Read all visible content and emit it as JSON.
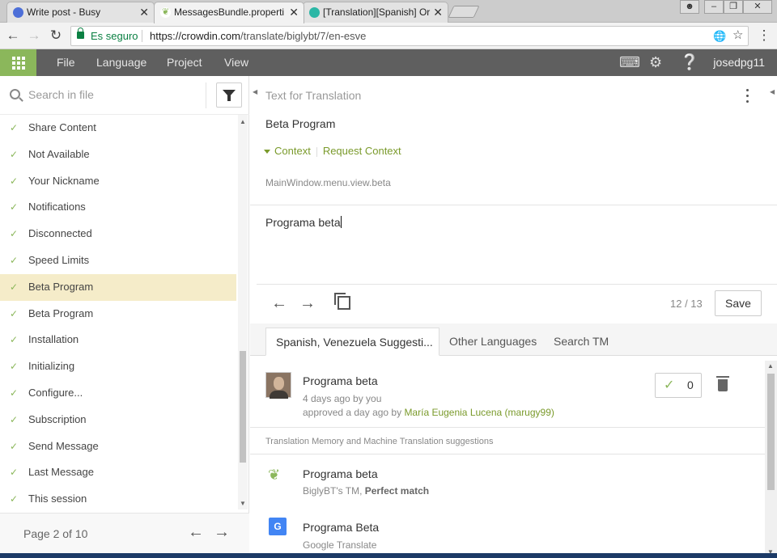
{
  "browser": {
    "tabs": [
      {
        "title": "Write post - Busy"
      },
      {
        "title": "MessagesBundle.properti"
      },
      {
        "title": "[Translation][Spanish] Or"
      }
    ],
    "security_label": "Es seguro",
    "url_host": "https://crowdin.com",
    "url_path": "/translate/biglybt/7/en-esve"
  },
  "appbar": {
    "menu": [
      "File",
      "Language",
      "Project",
      "View"
    ],
    "username": "josedpg11"
  },
  "sidebar": {
    "search_placeholder": "Search in file",
    "strings": [
      "Share Content",
      "Not Available",
      "Your Nickname",
      "Notifications",
      "Disconnected",
      "Speed Limits",
      "Beta Program",
      "Beta Program",
      "Installation",
      "Initializing",
      "Configure...",
      "Subscription",
      "Send Message",
      "Last Message",
      "This session"
    ],
    "selected_index": 6,
    "pager": "Page 2 of 10"
  },
  "editor": {
    "header": "Text for Translation",
    "source_text": "Beta Program",
    "context_label": "Context",
    "request_context_label": "Request Context",
    "context_key": "MainWindow.menu.view.beta",
    "translation_text": "Programa beta",
    "counter": "12 / 13",
    "save_label": "Save"
  },
  "suggestions": {
    "tabs": [
      "Spanish, Venezuela Suggesti...",
      "Other Languages",
      "Search TM"
    ],
    "active_tab": 0,
    "top": {
      "text": "Programa beta",
      "time": "4 days ago by you",
      "approved_prefix": "approved a day ago by",
      "approved_by": "María Eugenia Lucena (marugy99)",
      "votes": "0"
    },
    "tm_label": "Translation Memory and Machine Translation suggestions",
    "tm": [
      {
        "text": "Programa beta",
        "source": "BiglyBT's TM, ",
        "match": "Perfect match"
      },
      {
        "text": "Programa Beta",
        "source": "Google Translate",
        "match": ""
      }
    ]
  },
  "colors": {
    "accent_green": "#8bb75b",
    "appbar_bg": "#5f5f5f",
    "selected_row": "#f5ecc9",
    "link_green": "#7a9a2b"
  }
}
